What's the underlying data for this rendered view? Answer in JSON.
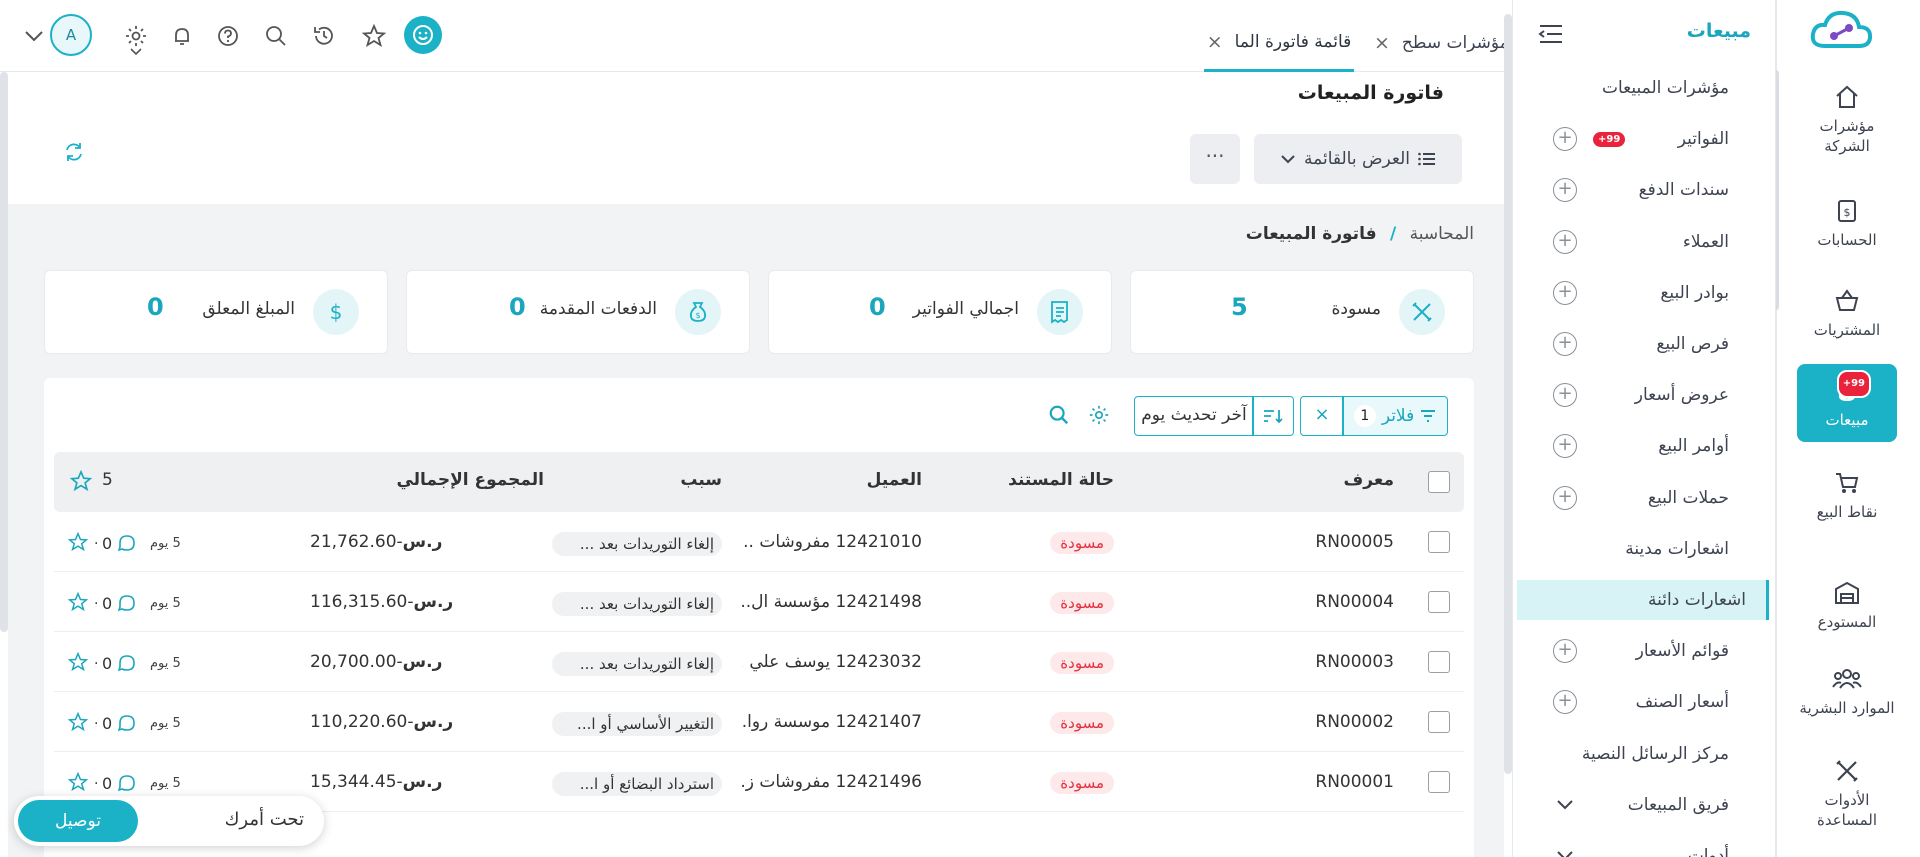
{
  "rail": {
    "items": [
      {
        "label": "مؤشرات الشركة",
        "icon": "home-icon"
      },
      {
        "label": "الحسابات",
        "icon": "document-dollar-icon"
      },
      {
        "label": "المشتريات",
        "icon": "basket-icon"
      },
      {
        "label": "مبيعات",
        "icon": "money-bag-icon",
        "badge": "+99"
      },
      {
        "label": "نقاط البيع",
        "icon": "cart-icon"
      },
      {
        "label": "المستودع",
        "icon": "warehouse-icon"
      },
      {
        "label": "الموارد البشرية",
        "icon": "people-icon"
      },
      {
        "label": "الأدوات المساعدة",
        "icon": "tools-icon"
      }
    ]
  },
  "submenu": {
    "title": "مبيعات",
    "items": [
      {
        "label": "مؤشرات المبيعات",
        "plus": false
      },
      {
        "label": "الفواتير",
        "plus": true,
        "badge": "+99"
      },
      {
        "label": "سندات الدفع",
        "plus": true
      },
      {
        "label": "العملاء",
        "plus": true
      },
      {
        "label": "بوادر البيع",
        "plus": true
      },
      {
        "label": "فرص البيع",
        "plus": true
      },
      {
        "label": "عروض أسعار",
        "plus": true
      },
      {
        "label": "أوامر البيع",
        "plus": true
      },
      {
        "label": "حملات البيع",
        "plus": true
      },
      {
        "label": "اشعارات مدينة",
        "plus": false
      },
      {
        "label": "اشعارات دائنة",
        "plus": false,
        "active": true
      },
      {
        "label": "قوائم الأسعار",
        "plus": true
      },
      {
        "label": "أسعار الصنف",
        "plus": true
      },
      {
        "label": "مركز الرسائل النصية",
        "plus": false
      },
      {
        "label": "فريق المبيعات",
        "chevron": true
      },
      {
        "label": "أدوات",
        "chevron": true
      }
    ]
  },
  "tabs": [
    {
      "label": "مؤشرات سطح",
      "close": "×"
    },
    {
      "label": "قائمة فاتورة الما",
      "close": "×",
      "active": true
    }
  ],
  "user": {
    "avatar": "A"
  },
  "page": {
    "title": "فاتورة المبيعات",
    "view_label": "العرض بالقائمة",
    "more_label": "···",
    "breadcrumb_parent": "المحاسبة",
    "breadcrumb_sep": "/",
    "breadcrumb_current": "فاتورة المبيعات"
  },
  "stats": [
    {
      "label": "مسودة",
      "value": "5",
      "icon": "tools-icon"
    },
    {
      "label": "اجمالي الفواتير",
      "value": "0",
      "icon": "receipt-icon"
    },
    {
      "label": "الدفعات المقدمة",
      "value": "0",
      "icon": "money-bag-icon"
    },
    {
      "label": "المبلغ المعلق",
      "value": "0",
      "icon": "dollar-icon"
    }
  ],
  "toolbar": {
    "filters_label": "فلاتر",
    "filters_count": "1",
    "clear": "×",
    "sort_label": "آخر تحديث يوم"
  },
  "table": {
    "headers": {
      "id": "معرف",
      "status": "حالة المستند",
      "customer": "العميل",
      "reason": "سبب",
      "total": "المجموع الإجمالي",
      "count": "5"
    },
    "rows": [
      {
        "id": "RN00005",
        "status": "مسودة",
        "customer": "12421010 مفروشات ...",
        "reason": "إلغاء التوريدات بعد ...",
        "total": "-21,762.60",
        "age": "5 يوم",
        "comments": "0",
        "dot": "·"
      },
      {
        "id": "RN00004",
        "status": "مسودة",
        "customer": "12421498 مؤسسة ال...",
        "reason": "إلغاء التوريدات بعد ...",
        "total": "-116,315.60",
        "age": "5 يوم",
        "comments": "0",
        "dot": "·"
      },
      {
        "id": "RN00003",
        "status": "مسودة",
        "customer": "12423032 يوسف علي ...",
        "reason": "إلغاء التوريدات بعد ...",
        "total": "-20,700.00",
        "age": "5 يوم",
        "comments": "0",
        "dot": "·"
      },
      {
        "id": "RN00002",
        "status": "مسودة",
        "customer": "12421407 موسسة روا...",
        "reason": "التغيير الأساسي أو ا...",
        "total": "-110,220.60",
        "age": "5 يوم",
        "comments": "0",
        "dot": "·"
      },
      {
        "id": "RN00001",
        "status": "مسودة",
        "customer": "12421496 مفروشات ز...",
        "reason": "استرداد البضائع أو ا...",
        "total": "-15,344.45",
        "age": "5 يوم",
        "comments": "0",
        "dot": "·"
      }
    ]
  },
  "chat": {
    "text": "تحت أمرك",
    "button": "توصيل"
  },
  "colors": {
    "accent": "#1bb1c6",
    "danger": "#e5303f",
    "badge": "#e8233b"
  }
}
